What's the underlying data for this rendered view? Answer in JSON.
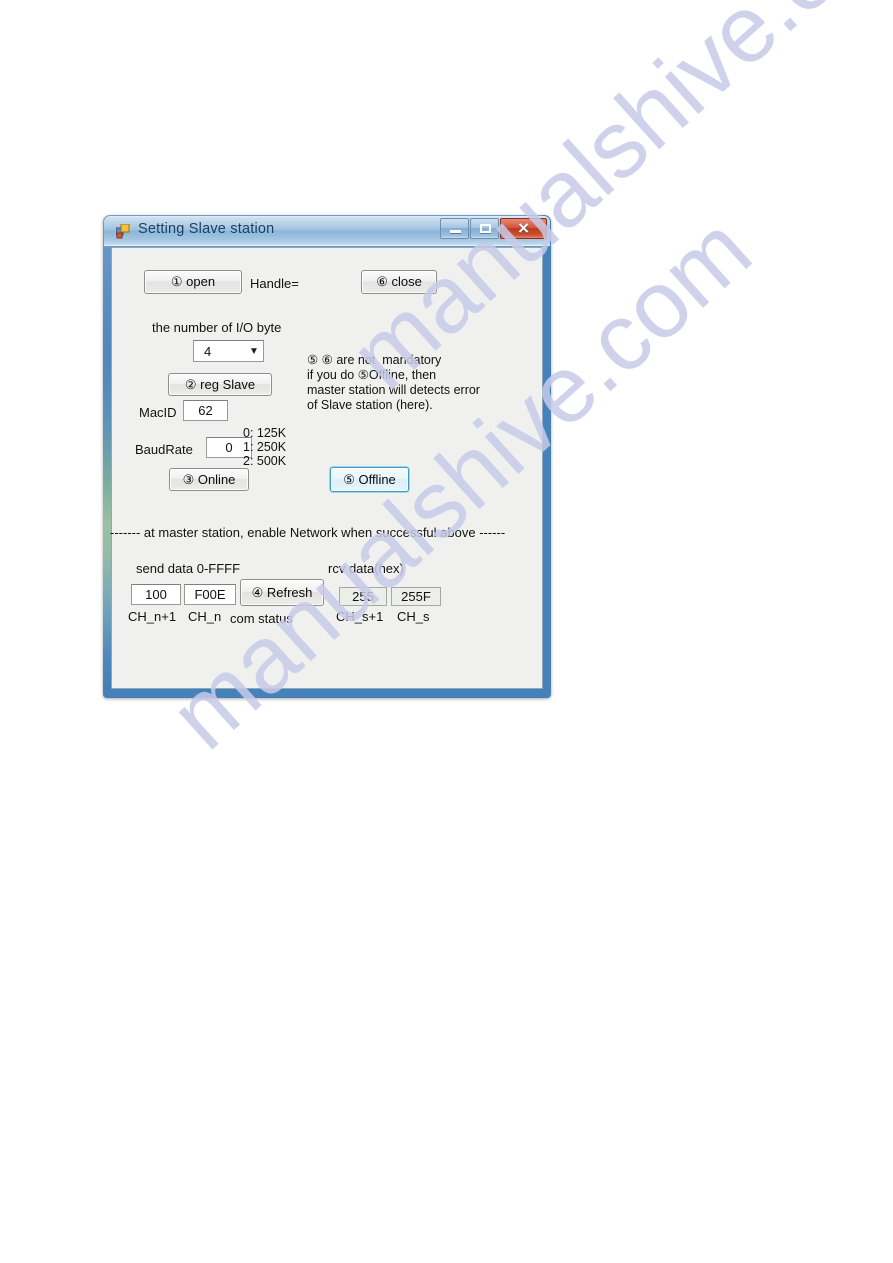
{
  "watermark": {
    "line1": "manualshive.com",
    "line2": "manualshive.com"
  },
  "window": {
    "title": "Setting Slave station",
    "icon": "app-form-icon",
    "controls": {
      "minimize": "minimize-icon",
      "maximize": "maximize-icon",
      "close": "close-icon",
      "close_glyph": "✕"
    }
  },
  "form": {
    "open_button": "① open",
    "handle_label": "Handle=",
    "close_button": "⑥ close",
    "io_byte_label": "the number of I/O byte",
    "io_byte_value": "4",
    "io_byte_arrow": "▼",
    "reg_slave_button": "② reg Slave",
    "macid_label": "MacID",
    "macid_value": "62",
    "baudrate_label": "BaudRate",
    "baudrate_value": "0",
    "baud_legend": "0: 125K\n1: 250K\n2: 500K",
    "online_button": "③ Online",
    "offline_button": "⑤ Offline",
    "note": "⑤ ⑥ are not  mandatory\nif you do ⑤Offline, then\nmaster station will detects error\nof Slave station (here).",
    "separator_text": "------- at master station, enable Network when successful above ------",
    "send_data_label": "send data  0-FFFF",
    "rcv_data_label": "rcv data(hex)",
    "send_hi_value": "100",
    "send_lo_value": "F00E",
    "send_hi_label": "CH_n+1",
    "send_lo_label": "CH_n",
    "refresh_button": "④ Refresh",
    "com_status_label": "com status",
    "rcv_hi_value": "255",
    "rcv_lo_value": "255F",
    "rcv_hi_label": "CH_s+1",
    "rcv_lo_label": "CH_s"
  }
}
